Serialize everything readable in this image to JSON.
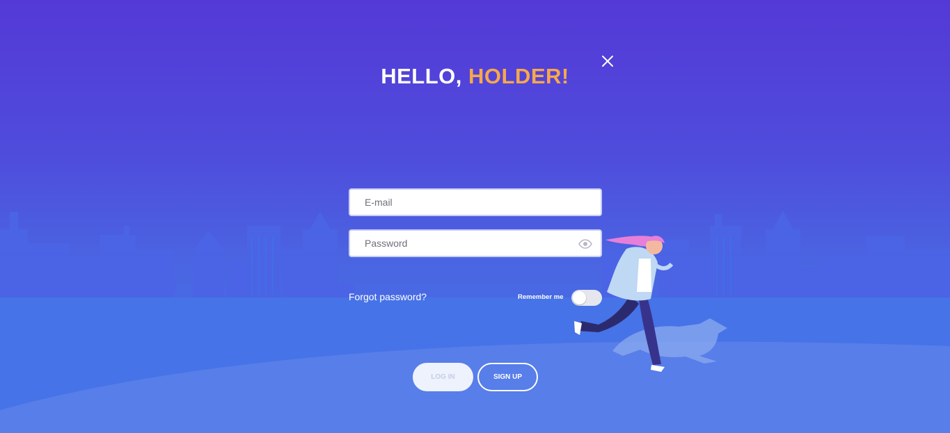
{
  "header": {
    "greeting": "HELLO,",
    "name": "HOLDER!",
    "close_icon": "close-icon"
  },
  "form": {
    "email": {
      "placeholder": "E-mail",
      "value": ""
    },
    "password": {
      "placeholder": "Password",
      "value": "",
      "toggle_icon": "eye-icon"
    },
    "forgot_password": "Forgot password?",
    "remember_me": {
      "label": "Remember me",
      "on": false
    }
  },
  "actions": {
    "login_label": "LOG IN",
    "signup_label": "SIGN UP"
  },
  "colors": {
    "background_top": "#5439d6",
    "background_bottom": "#4575e8",
    "accent": "#f7a84a",
    "hair": "#e77fd9"
  }
}
